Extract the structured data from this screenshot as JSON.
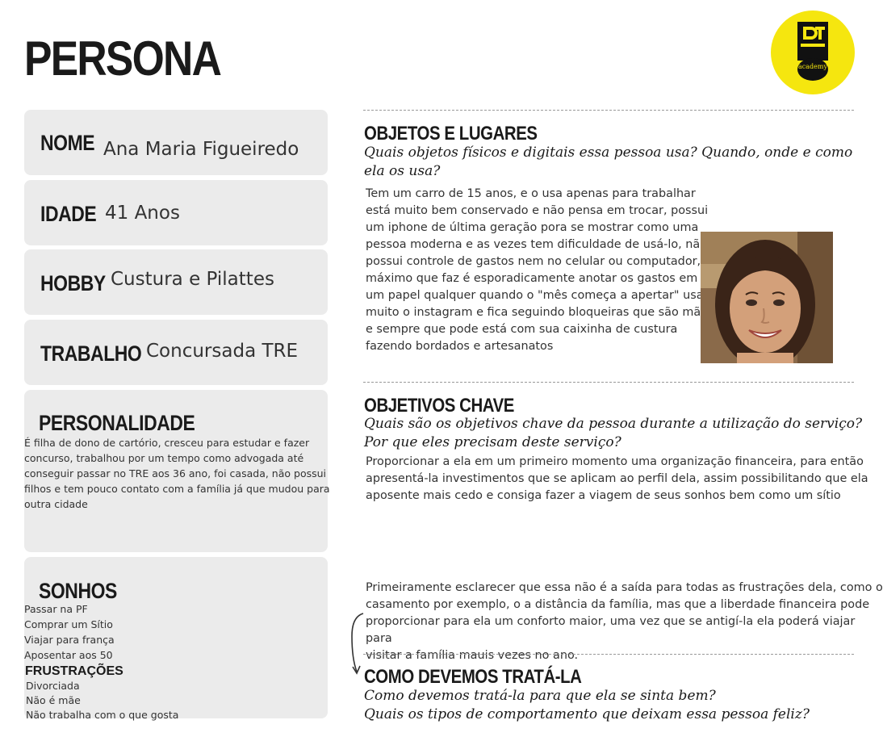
{
  "page_title": "PERSONA",
  "logo": {
    "text": "academy",
    "colors": {
      "background": "#f5e60f",
      "mark": "#111111"
    }
  },
  "profile": {
    "nome": {
      "label": "NOME",
      "value": "Ana Maria Figueiredo"
    },
    "idade": {
      "label": "IDADE",
      "value": "41 Anos"
    },
    "hobby": {
      "label": "HOBBY",
      "value": "Custura e Pilattes"
    },
    "trabalho": {
      "label": "TRABALHO",
      "value": "Concursada TRE"
    }
  },
  "personalidade": {
    "label": "PERSONALIDADE",
    "lines": [
      "É filha de dono de cartório, cresceu para estudar e fazer",
      "concurso, trabalhou por um tempo como advogada até",
      "conseguir passar no TRE aos 36 ano, foi casada, não possui",
      "filhos e tem pouco contato com a família já que mudou para",
      "outra cidade"
    ]
  },
  "sonhos": {
    "label": "SONHOS",
    "items": [
      "Passar na PF",
      "Comprar um Sítio",
      "Viajar para frança",
      "Aposentar aos 50"
    ]
  },
  "frustracoes": {
    "label": "FRUSTRAÇÕES",
    "items": [
      "Divorciada",
      "Não é mãe",
      "Não trabalha com o que gosta"
    ]
  },
  "objetos": {
    "title": "OBJETOS E LUGARES",
    "question_lines": [
      "Quais objetos físicos e digitais essa pessoa usa? Quando, onde e como",
      "ela os usa?"
    ],
    "body_lines": [
      "Tem um carro de 15 anos, e o usa apenas para trabalhar",
      "está muito bem conservado e não pensa em trocar, possui",
      "um iphone de última geração pora se mostrar como uma",
      "pessoa moderna e as vezes tem dificuldade de usá-lo, não",
      "possui controle de gastos nem no celular ou computador, o",
      "máximo que faz é esporadicamente anotar os gastos em",
      "um papel qualquer quando o \"mês começa a apertar\" usa",
      "muito o instagram e fica seguindo bloqueiras que são mãe,",
      "e sempre que pode está com sua caixinha de custura",
      "fazendo bordados e artesanatos"
    ]
  },
  "objetivos": {
    "title": "OBJETIVOS CHAVE",
    "question_lines": [
      "Quais são os objetivos chave da pessoa durante a utilização do serviço?",
      "Por que eles precisam deste serviço?"
    ],
    "body_lines": [
      "Proporcionar a ela em um primeiro momento uma organização financeira, para então",
      "apresentá-la investimentos que se aplicam ao perfil dela, assim possibilitando que ela",
      "aposente mais cedo e consiga fazer a viagem de seus sonhos bem como um sítio"
    ]
  },
  "tratamento_intro": {
    "body_lines": [
      "Primeiramente esclarecer que essa não é a saída para todas as frustrações dela, como o",
      "casamento por exemplo, o a distância da família, mas que a liberdade financeira pode",
      "proporcionar para ela um conforto maior, uma vez que se antigí-la ela poderá viajar para",
      "visitar a família mauis vezes no ano."
    ]
  },
  "como_tratar": {
    "title": "COMO DEVEMOS TRATÁ-LA",
    "question_lines": [
      "Como devemos tratá-la para que ela se sinta bem?",
      "Quais os tipos de comportamento que deixam essa pessoa feliz?"
    ]
  }
}
